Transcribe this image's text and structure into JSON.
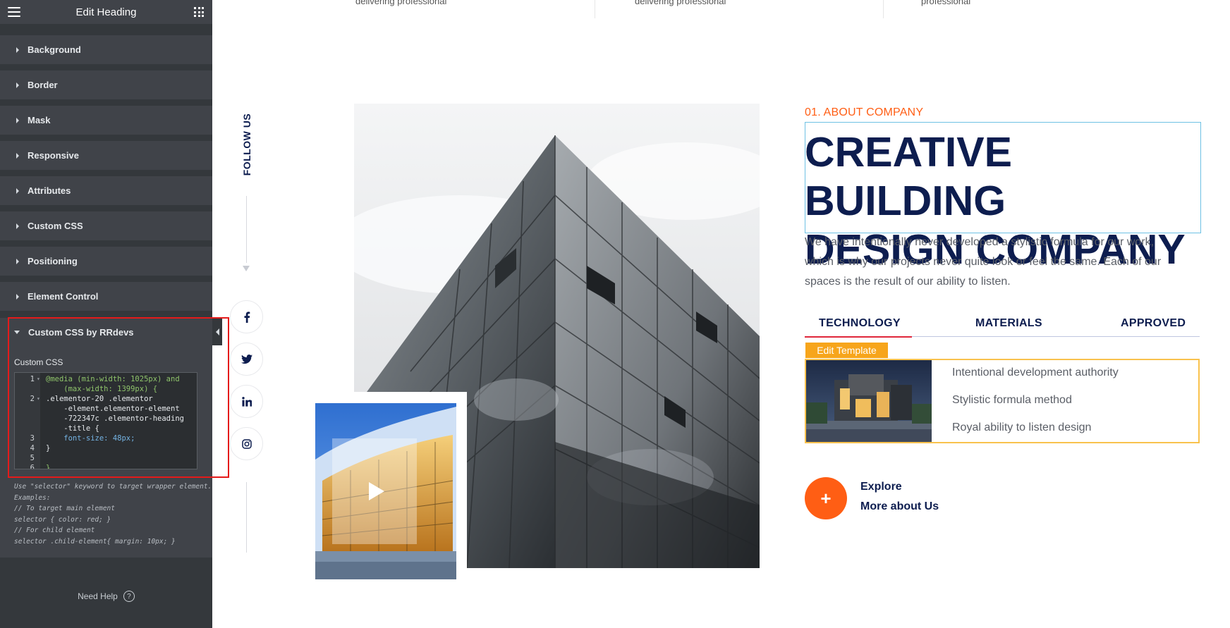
{
  "editor": {
    "title": "Edit Heading",
    "sections": [
      "Background",
      "Border",
      "Mask",
      "Responsive",
      "Attributes",
      "Custom CSS",
      "Positioning",
      "Element Control"
    ],
    "open_section": "Custom CSS by RRdevs",
    "css_field_label": "Custom CSS",
    "code_lines": [
      {
        "n": "1",
        "text": "@media (min-width: 1025px) and"
      },
      {
        "n": "",
        "text": "    (max-width: 1399px) {"
      },
      {
        "n": "2",
        "text": ".elementor-20 .elementor"
      },
      {
        "n": "",
        "text": "    -element.elementor-element"
      },
      {
        "n": "",
        "text": "    -722347c .elementor-heading"
      },
      {
        "n": "",
        "text": "    -title {"
      },
      {
        "n": "3",
        "text": "    font-size: 48px;"
      },
      {
        "n": "4",
        "text": "}"
      },
      {
        "n": "5",
        "text": ""
      },
      {
        "n": "6",
        "text": "}"
      }
    ],
    "hint_lines": [
      "Use \"selector\" keyword to target wrapper element.",
      "Examples:",
      "// To target main element",
      "selector { color: red; }",
      "// For child element",
      "selector .child-element{ margin: 10px; }"
    ],
    "need_help": "Need Help",
    "help_icon_glyph": "?"
  },
  "canvas": {
    "top_texts": [
      "delivering professional",
      "delivering professional",
      "professional"
    ],
    "follow_us": "FOLLOW US",
    "social_icons": [
      "facebook-icon",
      "twitter-icon",
      "linkedin-icon",
      "instagram-icon"
    ],
    "eyebrow": "01. ABOUT COMPANY",
    "heading_line1": "CREATIVE BUILDING",
    "heading_line2": "DESIGN COMPANY",
    "paragraph": "We have intentionally never developed a stylistic formula for our work, which is why our projects never quite look or feel the same. Each of our spaces is the result of our ability to listen.",
    "tabs": [
      "TECHNOLOGY",
      "MATERIALS",
      "APPROVED"
    ],
    "active_tab": "TECHNOLOGY",
    "edit_template": "Edit Template",
    "features": [
      "Intentional development authority",
      "Stylistic formula method",
      "Royal ability to listen design"
    ],
    "explore_icon": "+",
    "explore_line1": "Explore",
    "explore_line2": "More about Us"
  },
  "colors": {
    "panel_bg": "#34383c",
    "section_bg": "#404349",
    "accent_orange": "#ff5e14",
    "heading_navy": "#0d1d4f",
    "highlight_red": "#e51a1a",
    "template_yellow": "#f7a51b",
    "selection_blue": "#6ec1e4"
  }
}
